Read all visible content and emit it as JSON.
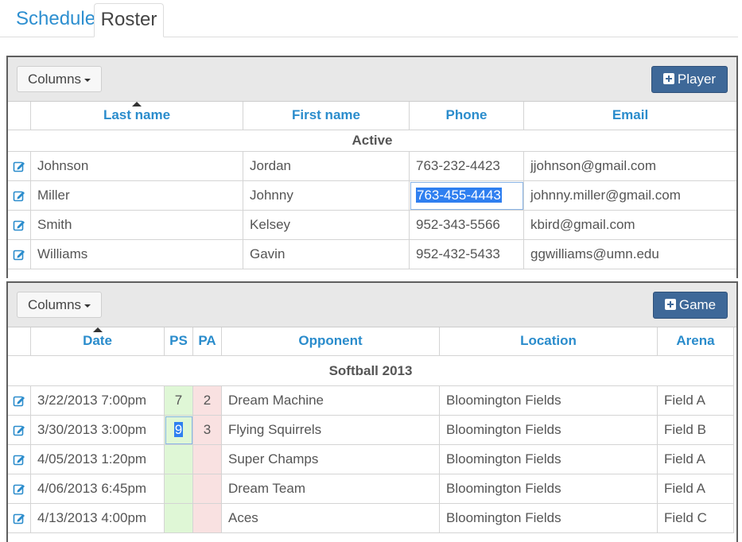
{
  "tabs": [
    {
      "label": "Schedule",
      "active": false
    },
    {
      "label": "Roster",
      "active": true
    }
  ],
  "players": {
    "columns_button": "Columns",
    "add_button": "Player",
    "headers": {
      "last": "Last name",
      "first": "First name",
      "phone": "Phone",
      "email": "Email"
    },
    "sort_column": "Last name",
    "group": "Active",
    "rows": [
      {
        "last": "Johnson",
        "first": "Jordan",
        "phone": "763-232-4423",
        "email": "jjohnson@gmail.com"
      },
      {
        "last": "Miller",
        "first": "Johnny",
        "phone": "763-455-4443",
        "email": "johnny.miller@gmail.com"
      },
      {
        "last": "Smith",
        "first": "Kelsey",
        "phone": "952-343-5566",
        "email": "kbird@gmail.com"
      },
      {
        "last": "Williams",
        "first": "Gavin",
        "phone": "952-432-5433",
        "email": "ggwilliams@umn.edu"
      }
    ]
  },
  "games": {
    "columns_button": "Columns",
    "add_button": "Game",
    "headers": {
      "date": "Date",
      "ps": "PS",
      "pa": "PA",
      "opponent": "Opponent",
      "location": "Location",
      "arena": "Arena"
    },
    "sort_column": "Date",
    "group": "Softball 2013",
    "rows": [
      {
        "date": "3/22/2013 7:00pm",
        "ps": "7",
        "pa": "2",
        "opponent": "Dream Machine",
        "location": "Bloomington Fields",
        "arena": "Field A"
      },
      {
        "date": "3/30/2013 3:00pm",
        "ps": "9",
        "pa": "3",
        "opponent": "Flying Squirrels",
        "location": "Bloomington Fields",
        "arena": "Field B"
      },
      {
        "date": "4/05/2013 1:20pm",
        "ps": "",
        "pa": "",
        "opponent": "Super Champs",
        "location": "Bloomington Fields",
        "arena": "Field A"
      },
      {
        "date": "4/06/2013 6:45pm",
        "ps": "",
        "pa": "",
        "opponent": "Dream Team",
        "location": "Bloomington Fields",
        "arena": "Field A"
      },
      {
        "date": "4/13/2013 4:00pm",
        "ps": "",
        "pa": "",
        "opponent": "Aces",
        "location": "Bloomington Fields",
        "arena": "Field C"
      }
    ]
  },
  "icons": {
    "edit": "edit-icon",
    "add": "plus-square-icon",
    "sort": "sort-ascending-icon",
    "dropdown": "caret-down-icon"
  },
  "colors": {
    "accent": "#2a8ccc",
    "add_button": "#3e6898",
    "points_scored": "#dff7d6",
    "points_against": "#f9e1e1",
    "selection": "#2f7ff0"
  }
}
